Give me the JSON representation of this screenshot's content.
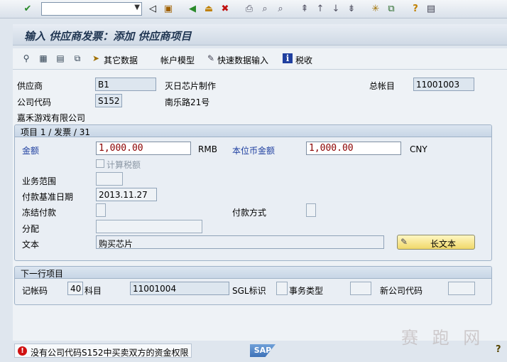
{
  "toolbar": {
    "command_field": ""
  },
  "title": "输入 供应商发票：添加 供应商项目",
  "app_toolbar": {
    "other_data": "其它数据",
    "account_model": "帐户模型",
    "fast_entry": "快速数据输入",
    "tax": "税收"
  },
  "header": {
    "vendor_label": "供应商",
    "vendor_value": "B1",
    "vendor_name": "灭日芯片制作",
    "gl_label": "总帐目",
    "gl_value": "11001003",
    "company_code_label": "公司代码",
    "company_code_value": "S152",
    "address": "南乐路21号",
    "company_name": "嘉禾游戏有限公司"
  },
  "item": {
    "group_title": "项目 1 / 发票 / 31",
    "amount_label": "金额",
    "amount_value": "1,000.00",
    "amount_currency": "RMB",
    "local_amount_label": "本位币金额",
    "local_amount_value": "1,000.00",
    "local_currency": "CNY",
    "calc_tax_label": "计算税额",
    "business_area_label": "业务范围",
    "baseline_date_label": "付款基准日期",
    "baseline_date_value": "2013.11.27",
    "payment_block_label": "冻结付款",
    "payment_method_label": "付款方式",
    "assignment_label": "分配",
    "text_label": "文本",
    "text_value": "购买芯片",
    "long_text_button": "长文本"
  },
  "next_item": {
    "group_title": "下一行项目",
    "posting_key_label": "记帐码",
    "posting_key_value": "40",
    "account_label": "科目",
    "account_value": "11001004",
    "sgl_label": "SGL标识",
    "transaction_type_label": "事务类型",
    "new_company_code_label": "新公司代码"
  },
  "status": {
    "message": "没有公司代码S152中买卖双方的资金权限",
    "sap_logo": "SAP"
  },
  "watermark": "赛 跑 网"
}
